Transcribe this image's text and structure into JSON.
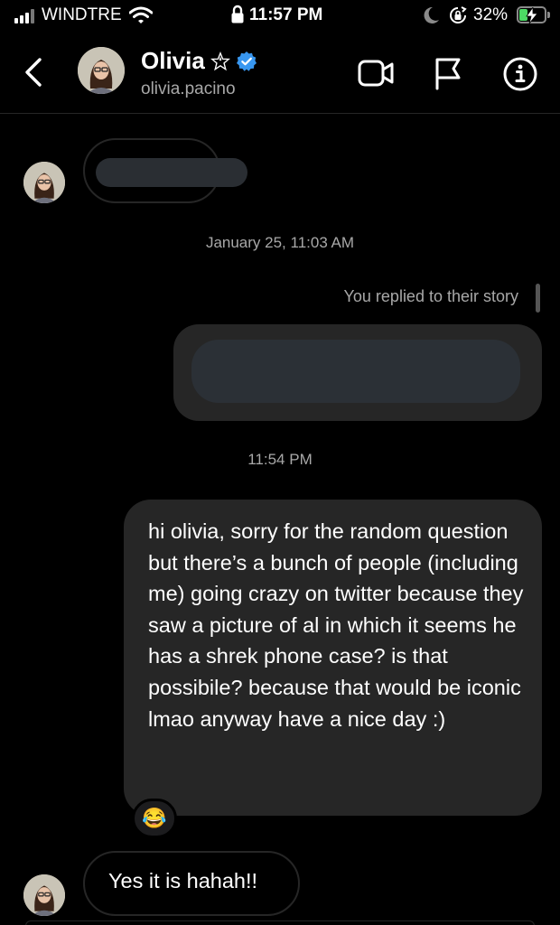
{
  "status_bar": {
    "carrier": "WINDTRE",
    "time": "11:57 PM",
    "battery_percent": "32%",
    "battery_level": 0.32,
    "icons": [
      "signal-icon",
      "wifi-icon",
      "lock-icon",
      "moon-icon",
      "orientation-lock-icon",
      "battery-charging-icon"
    ]
  },
  "header": {
    "name": "Olivia",
    "username": "olivia.pacino",
    "badges": [
      "star-icon",
      "verified-icon"
    ],
    "actions": [
      "video-call-icon",
      "flag-icon",
      "info-icon"
    ]
  },
  "chat": {
    "timestamp_1": "January 25, 11:03 AM",
    "story_reply_label": "You replied to their story",
    "timestamp_2": "11:54 PM",
    "sent_message": "hi olivia, sorry for the random question but there’s a bunch of people (including me) going crazy on twitter because they saw a picture of al in which it seems he has a shrek phone case? is that possibile? because that would be iconic lmao anyway have a nice day :)",
    "reaction": "😂",
    "received_reply": "Yes it is hahah!!"
  },
  "colors": {
    "background": "#000000",
    "bubble_sent": "#262626",
    "secondary_text": "#a8a8a8",
    "verified": "#3897f0",
    "battery_fill": "#4cd964"
  }
}
